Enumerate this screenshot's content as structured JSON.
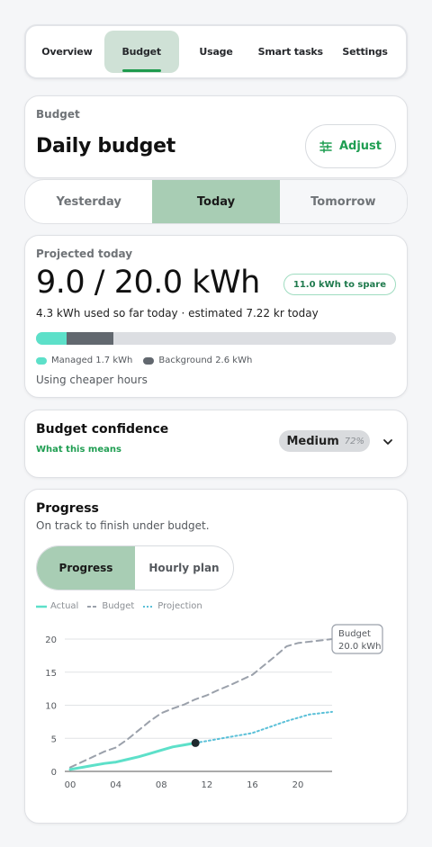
{
  "nav": {
    "tabs": [
      {
        "label": "Overview"
      },
      {
        "label": "Budget"
      },
      {
        "label": "Usage"
      },
      {
        "label": "Smart tasks"
      },
      {
        "label": "Settings"
      }
    ],
    "active": "Budget"
  },
  "budget": {
    "eyebrow": "Budget",
    "title": "Daily budget",
    "adjust_label": "Adjust"
  },
  "days": {
    "tabs": [
      {
        "label": "Yesterday"
      },
      {
        "label": "Today"
      },
      {
        "label": "Tomorrow"
      }
    ],
    "active": "Today"
  },
  "projected": {
    "eyebrow": "Projected today",
    "value": "9.0 / 20.0 kWh",
    "spare_badge": "11.0 kWh to spare",
    "subline": "4.3 kWh used so far today · estimated 7.22 kr today",
    "bar": {
      "budget_kwh": 20.0,
      "managed_kwh": 1.7,
      "background_kwh": 2.6
    },
    "legend_managed": "Managed 1.7 kWh",
    "legend_background": "Background 2.6 kWh",
    "note": "Using cheaper hours"
  },
  "confidence": {
    "title": "Budget confidence",
    "link": "What this means",
    "level": "Medium",
    "percent": "72%"
  },
  "progress": {
    "title": "Progress",
    "subtitle": "On track to finish under budget.",
    "toggle": [
      {
        "label": "Progress"
      },
      {
        "label": "Hourly plan"
      }
    ],
    "active_view": "Progress",
    "legend": {
      "actual": "Actual",
      "budget": "Budget",
      "projection": "Projection"
    },
    "callout_title": "Budget",
    "callout_value": "20.0 kWh"
  },
  "colors": {
    "accent_green": "#1f9e52",
    "active_tab": "#a8cdb4",
    "managed": "#5de0c9",
    "background": "#62686f",
    "actual_line": "#5de0c9",
    "budget_line": "#9ba1ab",
    "projection_line": "#5bc0d8"
  },
  "icons": {
    "adjust": "sliders-icon",
    "chevron": "chevron-down-icon"
  },
  "chart_data": {
    "type": "line",
    "xlabel": "",
    "ylabel": "",
    "xlim": [
      0,
      23
    ],
    "ylim": [
      0,
      20
    ],
    "x_ticks": [
      "00",
      "04",
      "08",
      "12",
      "16",
      "20"
    ],
    "x_tick_values": [
      0,
      4,
      8,
      12,
      16,
      20
    ],
    "y_ticks": [
      0,
      5,
      10,
      15,
      20
    ],
    "grid": "horizontal",
    "legend": "top-left",
    "series": [
      {
        "name": "Actual",
        "style": "solid",
        "x": [
          0,
          1,
          2,
          3,
          4,
          5,
          6,
          7,
          8,
          9,
          10,
          11
        ],
        "y": [
          0.3,
          0.6,
          0.9,
          1.2,
          1.4,
          1.8,
          2.2,
          2.7,
          3.2,
          3.7,
          4.0,
          4.3
        ]
      },
      {
        "name": "Budget",
        "style": "dashed",
        "x": [
          0,
          1,
          2,
          3,
          4,
          5,
          6,
          7,
          8,
          9,
          10,
          11,
          12,
          13,
          14,
          15,
          16,
          17,
          18,
          19,
          20,
          21,
          22,
          23
        ],
        "y": [
          0.6,
          1.4,
          2.2,
          3.0,
          3.6,
          4.8,
          6.2,
          7.6,
          8.8,
          9.5,
          10.1,
          10.9,
          11.5,
          12.3,
          13.0,
          13.8,
          14.6,
          16.0,
          17.4,
          18.9,
          19.4,
          19.6,
          19.8,
          20.0
        ]
      },
      {
        "name": "Projection",
        "style": "dotted",
        "x": [
          11,
          12,
          13,
          14,
          15,
          16,
          17,
          18,
          19,
          20,
          21,
          22,
          23
        ],
        "y": [
          4.3,
          4.6,
          4.9,
          5.2,
          5.5,
          5.8,
          6.4,
          7.0,
          7.6,
          8.1,
          8.6,
          8.8,
          9.0
        ]
      }
    ],
    "marker": {
      "x": 11,
      "y": 4.3
    },
    "annotation": {
      "text": "Budget 20.0 kWh",
      "x": 23,
      "y": 20
    }
  }
}
